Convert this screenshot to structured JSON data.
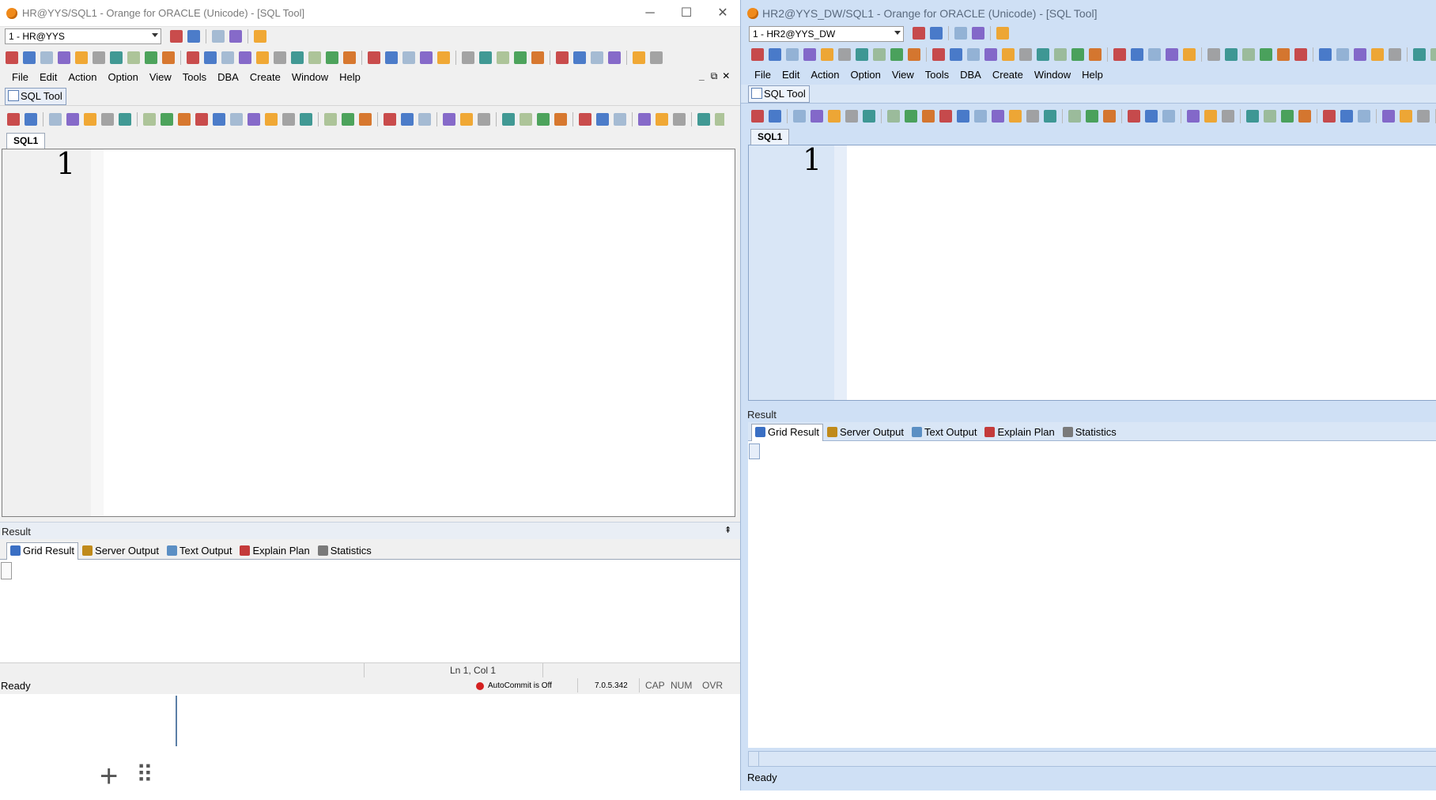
{
  "left": {
    "title": "HR@YYS/SQL1 - Orange for ORACLE (Unicode) - [SQL Tool]",
    "window_controls": {
      "minimize": "─",
      "maximize": "☐",
      "close": "✕"
    },
    "connection": "1 - HR@YYS",
    "menu": [
      "File",
      "Edit",
      "Action",
      "Option",
      "View",
      "Tools",
      "DBA",
      "Create",
      "Window",
      "Help"
    ],
    "mdi_controls": {
      "minimize": "_",
      "restore": "⧉",
      "close": "✕"
    },
    "doc_tab": "SQL Tool",
    "editor_tab": "SQL1",
    "line_number": "1",
    "result_label": "Result",
    "pin": "⇞",
    "result_tabs": [
      "Grid Result",
      "Server Output",
      "Text Output",
      "Explain Plan",
      "Statistics"
    ],
    "cursor_pos": "Ln 1, Col 1",
    "status": "Ready",
    "autocommit": "AutoCommit is Off",
    "version": "7.0.5.342",
    "cap": "CAP",
    "num": "NUM",
    "ovr": "OVR",
    "plus": "+",
    "grip": "⠿"
  },
  "right": {
    "title": "HR2@YYS_DW/SQL1 - Orange for ORACLE (Unicode) - [SQL Tool]",
    "connection": "1 - HR2@YYS_DW",
    "menu": [
      "File",
      "Edit",
      "Action",
      "Option",
      "View",
      "Tools",
      "DBA",
      "Create",
      "Window",
      "Help"
    ],
    "doc_tab": "SQL Tool",
    "editor_tab": "SQL1",
    "line_number": "1",
    "result_label": "Result",
    "result_tabs": [
      "Grid Result",
      "Server Output",
      "Text Output",
      "Explain Plan",
      "Statistics"
    ],
    "status": "Ready"
  },
  "colors": {
    "accent_orange": "#f08a1a",
    "blue_chrome": "#cfe0f5",
    "autocommit_dot": "#d42020"
  },
  "icons": {
    "app": "orange-app-icon",
    "toolbar": "toolbar-action-icon",
    "sql_tool": "sql-tool-icon",
    "grid_result": "grid-result-icon",
    "server_output": "server-output-icon",
    "text_output": "text-output-icon",
    "explain_plan": "explain-plan-icon",
    "statistics": "statistics-icon"
  }
}
